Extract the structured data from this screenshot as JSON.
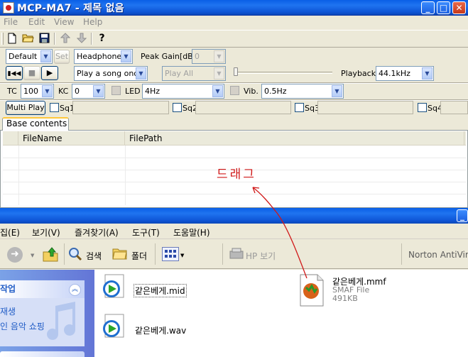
{
  "app_window": {
    "title": "MCP-MA7 - 제목 없음",
    "controls": {
      "minimize": "_",
      "maximize": "□",
      "close": "✕"
    },
    "menu": [
      "File",
      "Edit",
      "View",
      "Help"
    ],
    "toolbar_icons": [
      "new-file-icon",
      "open-folder-icon",
      "save-icon",
      "up-arrow-icon",
      "down-arrow-icon",
      "help-icon"
    ],
    "settings_row": {
      "preset": "Default",
      "set_button": "Set",
      "output": "Headphone",
      "peak_gain_label": "Peak Gain[dB]",
      "peak_gain_value": "0"
    },
    "playback_row": {
      "mode": "Play a song once",
      "play_all": "Play All",
      "playback_label": "Playback",
      "playback_rate": "44.1kHz"
    },
    "param_row": {
      "tc_label": "TC",
      "tc_value": "100",
      "kc_label": "KC",
      "kc_value": "0",
      "led_label": "LED",
      "led_value": "4Hz",
      "vib_label": "Vib.",
      "vib_value": "0.5Hz"
    },
    "multiplay_row": {
      "button": "Multi Play",
      "sequences": [
        "Sq1",
        "Sq2",
        "Sq3",
        "Sq4"
      ]
    },
    "tab": "Base contents",
    "list_columns": [
      "FileName",
      "FilePath"
    ],
    "annotation": "드래그"
  },
  "explorer_window": {
    "menu": [
      "집(E)",
      "보기(V)",
      "즐겨찾기(A)",
      "도구(T)",
      "도움말(H)"
    ],
    "toolbar": {
      "search": "검색",
      "folders": "폴더",
      "hp": "HP 보기",
      "norton": "Norton AntiVirus"
    },
    "task_panel": {
      "title": "작업",
      "links": [
        "재생",
        "인 음악 쇼핑"
      ]
    },
    "files": [
      {
        "name": "같은베게.mid"
      },
      {
        "name": "같은베게.wav"
      },
      {
        "name": "같은베게.mmf",
        "type": "SMAF File",
        "size": "491KB"
      }
    ]
  },
  "colors": {
    "titlebar": "#0a5fe6",
    "accent_link": "#215dc6",
    "annotation": "#d01818"
  }
}
